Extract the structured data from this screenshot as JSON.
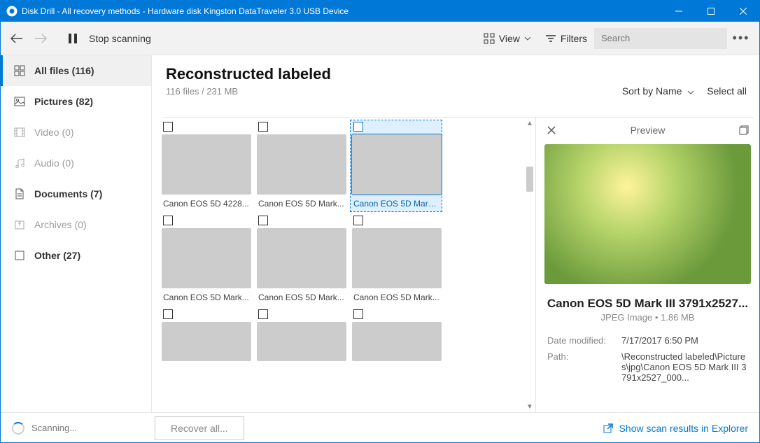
{
  "titlebar": {
    "title": "Disk Drill - All recovery methods - Hardware disk Kingston DataTraveler 3.0 USB Device"
  },
  "toolbar": {
    "stop_label": "Stop scanning",
    "view_label": "View",
    "filters_label": "Filters",
    "search_placeholder": "Search"
  },
  "sidebar": {
    "items": [
      {
        "label": "All files (116)",
        "icon": "grid",
        "bold": true,
        "active": true
      },
      {
        "label": "Pictures (82)",
        "icon": "image",
        "bold": true,
        "active": false
      },
      {
        "label": "Video (0)",
        "icon": "film",
        "bold": false,
        "active": false,
        "dim": true
      },
      {
        "label": "Audio (0)",
        "icon": "music",
        "bold": false,
        "active": false,
        "dim": true
      },
      {
        "label": "Documents (7)",
        "icon": "doc",
        "bold": true,
        "active": false
      },
      {
        "label": "Archives (0)",
        "icon": "archive",
        "bold": false,
        "active": false,
        "dim": true
      },
      {
        "label": "Other (27)",
        "icon": "square",
        "bold": true,
        "active": false
      }
    ]
  },
  "content": {
    "heading": "Reconstructed labeled",
    "subline": "116 files / 231 MB",
    "sort_label": "Sort by Name",
    "select_all_label": "Select all",
    "items": [
      {
        "caption": "Canon EOS 5D 4228...",
        "ph": "ph1",
        "selected": false
      },
      {
        "caption": "Canon EOS 5D Mark...",
        "ph": "ph2",
        "selected": false
      },
      {
        "caption": "Canon EOS 5D Mark...",
        "ph": "ph3",
        "selected": true
      },
      {
        "caption": "Canon EOS 5D Mark...",
        "ph": "ph4",
        "selected": false
      },
      {
        "caption": "Canon EOS 5D Mark...",
        "ph": "ph5",
        "selected": false
      },
      {
        "caption": "Canon EOS 5D Mark...",
        "ph": "ph6",
        "selected": false
      },
      {
        "caption": "",
        "ph": "ph7",
        "selected": false,
        "short": true
      },
      {
        "caption": "",
        "ph": "ph8",
        "selected": false,
        "short": true
      },
      {
        "caption": "",
        "ph": "ph9",
        "selected": false,
        "short": true
      }
    ]
  },
  "preview": {
    "header_label": "Preview",
    "filename": "Canon EOS 5D Mark III 3791x2527...",
    "type_size": "JPEG Image • 1.86 MB",
    "props": [
      {
        "label": "Date modified:",
        "value": "7/17/2017 6:50 PM"
      },
      {
        "label": "Path:",
        "value": "\\Reconstructed labeled\\Pictures\\jpg\\Canon EOS 5D Mark III 3791x2527_000..."
      }
    ]
  },
  "footer": {
    "status": "Scanning...",
    "recover_label": "Recover all...",
    "explorer_label": "Show scan results in Explorer"
  }
}
